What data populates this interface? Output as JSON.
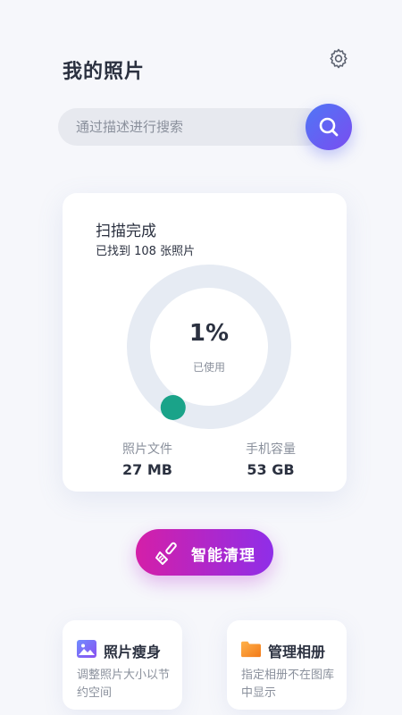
{
  "status_bar": {
    "left_text": "",
    "right_text": ""
  },
  "header": {
    "title": "我的照片",
    "settings_icon": "gear-icon"
  },
  "search": {
    "placeholder": "通过描述进行搜索",
    "value": "",
    "button_icon": "search-icon"
  },
  "storage_card": {
    "scan_title": "扫描完成",
    "scan_subtitle": "已找到 108 张照片",
    "usage_percent_text": "1%",
    "usage_percent_value": 1,
    "usage_label": "已使用",
    "photos_label": "照片文件",
    "photos_value": "27 MB",
    "phone_label": "手机容量",
    "phone_value": "53 GB",
    "ring_track_color": "#e6ebf3",
    "ring_progress_color": "#1aa389"
  },
  "clean_button": {
    "label": "智能清理",
    "icon": "broom-icon"
  },
  "features": [
    {
      "title": "照片瘦身",
      "description": "调整照片大小以节约空间",
      "icon": "image-icon"
    },
    {
      "title": "管理相册",
      "description": "指定相册不在图库中显示",
      "icon": "folder-icon"
    }
  ]
}
